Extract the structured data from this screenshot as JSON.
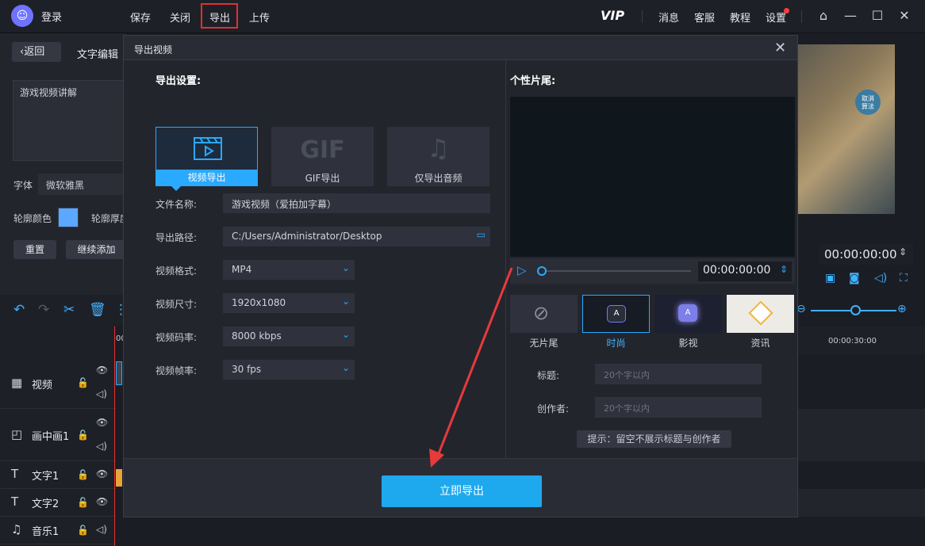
{
  "topbar": {
    "login": "登录",
    "menu": [
      "保存",
      "关闭",
      "导出",
      "上传"
    ],
    "vip": "VIP",
    "right_menu": [
      "消息",
      "客服",
      "教程",
      "设置"
    ]
  },
  "left_panel": {
    "back": "返回",
    "tab": "文字编辑",
    "text_content": "游戏视频讲解",
    "font_label": "字体",
    "font_value": "微软雅黑",
    "outline_color_label": "轮廓颜色",
    "outline_width_label": "轮廓厚度",
    "outline_color": "#5aa8ff",
    "reset": "重置",
    "continue_add": "继续添加"
  },
  "tracks": [
    {
      "name": "视频",
      "icon": "film-icon"
    },
    {
      "name": "画中画1",
      "icon": "pip-icon"
    },
    {
      "name": "文字1",
      "icon": "text-icon"
    },
    {
      "name": "文字2",
      "icon": "text-icon"
    },
    {
      "name": "音乐1",
      "icon": "music-icon"
    }
  ],
  "right_side": {
    "timecode": "00:00:00:00",
    "ruler_label": "00:00:30:00",
    "ruler_label_short": "00",
    "preview_badge": "取消\n算法"
  },
  "dialog": {
    "title": "导出视频",
    "export_settings": "导出设置:",
    "modes": [
      {
        "label": "视频导出",
        "active": true
      },
      {
        "label": "GIF导出",
        "active": false
      },
      {
        "label": "仅导出音频",
        "active": false
      }
    ],
    "gif_text": "GIF",
    "fields": {
      "filename_label": "文件名称:",
      "filename": "游戏视频（爱拍加字幕）",
      "path_label": "导出路径:",
      "path": "C:/Users/Administrator/Desktop",
      "format_label": "视频格式:",
      "format": "MP4",
      "size_label": "视频尺寸:",
      "size": "1920x1080",
      "bitrate_label": "视频码率:",
      "bitrate": "8000 kbps",
      "fps_label": "视频帧率:",
      "fps": "30 fps"
    },
    "ending": {
      "title": "个性片尾:",
      "timecode": "00:00:00:00",
      "templates": [
        {
          "label": "无片尾",
          "active": false
        },
        {
          "label": "时尚",
          "active": true
        },
        {
          "label": "影视",
          "active": false
        },
        {
          "label": "资讯",
          "active": false
        }
      ],
      "title_label": "标题:",
      "title_placeholder": "20个字以内",
      "author_label": "创作者:",
      "author_placeholder": "20个字以内",
      "tip": "提示：留空不展示标题与创作者"
    },
    "export_now": "立即导出"
  }
}
